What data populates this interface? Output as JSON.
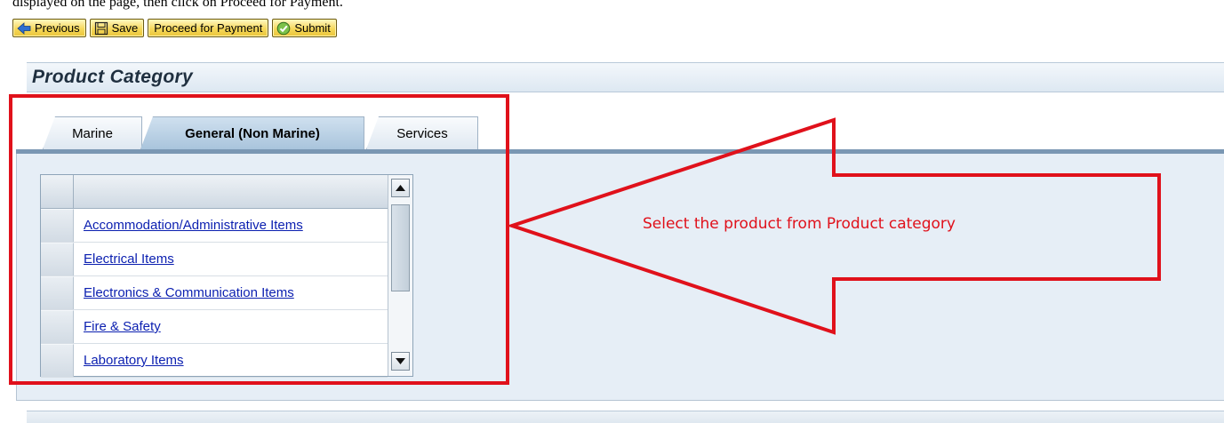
{
  "top_text": "displayed on the page, then click on Proceed for Payment.",
  "toolbar": {
    "previous_label": "Previous",
    "save_label": "Save",
    "proceed_label": "Proceed for Payment",
    "submit_label": "Submit",
    "icons": [
      "arrow-left-icon",
      "save-icon",
      "check-circle-icon"
    ]
  },
  "section": {
    "title": "Product Category"
  },
  "tabs": [
    {
      "label": "Marine",
      "active": false
    },
    {
      "label": "General (Non Marine)",
      "active": true
    },
    {
      "label": "Services",
      "active": false
    }
  ],
  "grid": {
    "rows": [
      "Accommodation/Administrative Items",
      "Electrical Items",
      "Electronics & Communication Items",
      "Fire & Safety",
      "Laboratory Items"
    ]
  },
  "annotation": {
    "text": "Select the product from Product category",
    "color": "#e0111b"
  },
  "colors": {
    "button_gold": "#f6d85a",
    "link_blue": "#0b1fb0",
    "tab_bar": "#7a97b3",
    "panel": "#e6eef6"
  }
}
